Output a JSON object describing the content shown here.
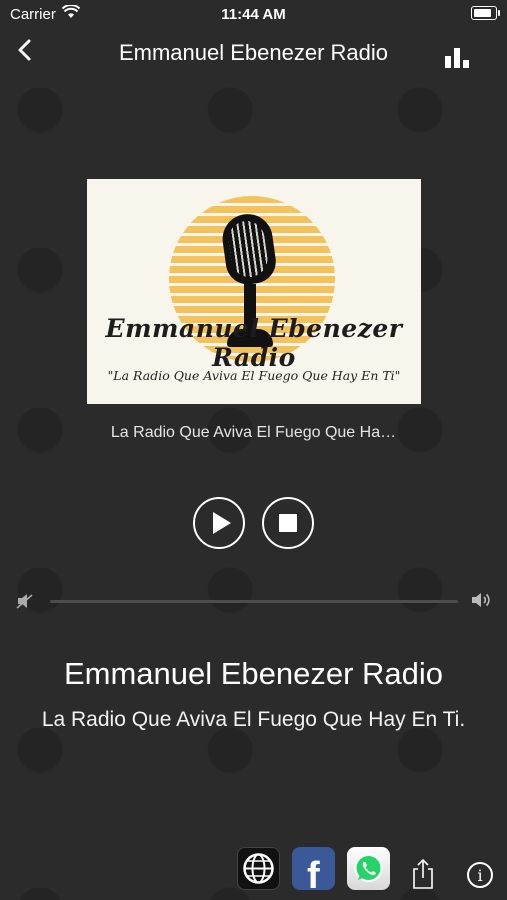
{
  "status_bar": {
    "carrier": "Carrier",
    "time": "11:44 AM"
  },
  "nav": {
    "title": "Emmanuel Ebenezer Radio",
    "back_icon": "chevron-left-icon",
    "equalizer_icon": "equalizer-icon"
  },
  "logo": {
    "brand": "Emmanuel Ebenezer Radio",
    "slogan": "\"La Radio Que Aviva El Fuego Que Hay En Ti\""
  },
  "player": {
    "now_playing": "La Radio Que Aviva El Fuego Que Ha…",
    "play_icon": "play-icon",
    "stop_icon": "stop-icon",
    "volume_level": 0.0
  },
  "station": {
    "name": "Emmanuel Ebenezer Radio",
    "slogan": "La Radio Que Aviva El Fuego Que Hay En Ti."
  },
  "toolbar": {
    "website_icon": "globe-icon",
    "facebook_icon": "facebook-icon",
    "facebook_letter": "f",
    "whatsapp_icon": "whatsapp-icon",
    "share_icon": "share-icon",
    "info_icon": "info-icon",
    "info_letter": "i"
  },
  "colors": {
    "background": "#2b2b2b",
    "facebook": "#3b5998",
    "whatsapp": "#25d366",
    "sun": "#f3c25a"
  }
}
